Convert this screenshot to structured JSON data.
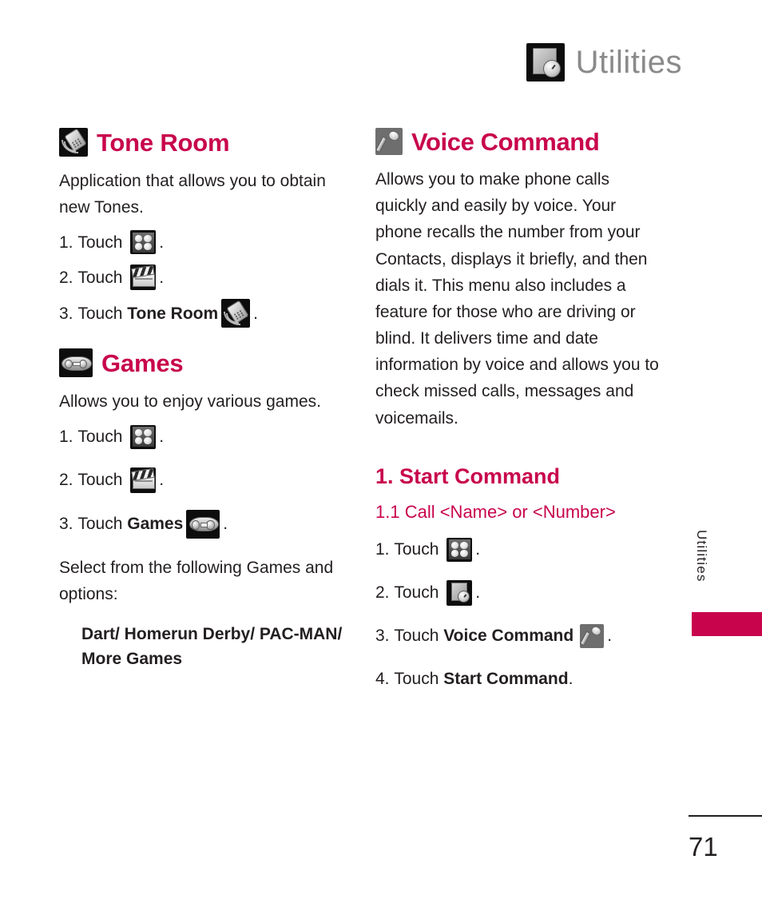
{
  "header": {
    "title": "Utilities",
    "icon": "utilities-icon"
  },
  "left_column": {
    "sections": [
      {
        "id": "tone-room",
        "icon": "tone-room-icon",
        "heading": "Tone Room",
        "body": "Application that allows you to obtain new Tones.",
        "steps": [
          {
            "num": "1. ",
            "label": "Touch ",
            "bold": "",
            "icon": "grid-menu-icon",
            "end": "."
          },
          {
            "num": "2. ",
            "label": "Touch ",
            "bold": "",
            "icon": "clapperboard-icon",
            "end": "."
          },
          {
            "num": "3. ",
            "label": "Touch ",
            "bold": "Tone Room",
            "icon": "tone-room-icon",
            "end": "."
          }
        ]
      },
      {
        "id": "games",
        "icon": "gamepad-icon",
        "heading": "Games",
        "body": "Allows you to enjoy various games.",
        "steps": [
          {
            "num": "1. ",
            "label": "Touch ",
            "bold": "",
            "icon": "grid-menu-icon",
            "end": "."
          },
          {
            "num": "2. ",
            "label": "Touch ",
            "bold": "",
            "icon": "clapperboard-icon",
            "end": "."
          },
          {
            "num": "3. ",
            "label": "Touch ",
            "bold": "Games",
            "icon": "gamepad-icon",
            "end": "."
          }
        ],
        "select_text": "Select from the following Games and options:",
        "options_text": "Dart/ Homerun Derby/ PAC-MAN/ More Games"
      }
    ]
  },
  "right_column": {
    "section": {
      "id": "voice-command",
      "icon": "microphone-icon",
      "heading": "Voice Command",
      "body": "Allows you to make phone calls quickly and easily by voice. Your phone recalls the number from your Contacts, displays it briefly, and then dials it. This menu also includes a feature for those who are driving or blind. It delivers time and date information by voice and allows you to check missed calls, messages and voicemails.",
      "sub_heading": "1. Start Command",
      "sub_sub_heading": "1.1  Call <Name> or <Number>",
      "steps": [
        {
          "num": "1. ",
          "label": "Touch ",
          "bold": "",
          "icon": "grid-menu-icon",
          "end": "."
        },
        {
          "num": "2. ",
          "label": "Touch ",
          "bold": "",
          "icon": "utilities-icon",
          "end": "."
        },
        {
          "num": "3. ",
          "label": "Touch ",
          "bold": "Voice Command",
          "icon": "microphone-icon",
          "end": "."
        },
        {
          "num": "4. ",
          "label": "Touch ",
          "bold": "Start Command",
          "icon": "",
          "end": "."
        }
      ]
    }
  },
  "side_tab": {
    "label": "Utilities",
    "color": "#c8054c"
  },
  "footer": {
    "page_number": "71"
  },
  "colors": {
    "accent": "#c8054c",
    "header_grey": "#8a8a8a",
    "body": "#231f20"
  }
}
